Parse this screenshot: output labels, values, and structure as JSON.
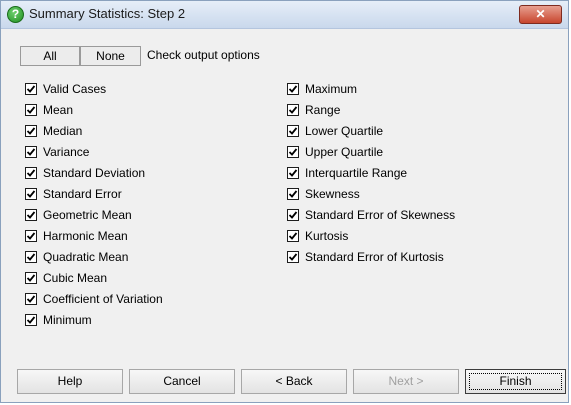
{
  "window": {
    "title": "Summary Statistics: Step 2",
    "close_label": "✕"
  },
  "top_controls": {
    "all_label": "All",
    "none_label": "None",
    "check_options_label": "Check output options"
  },
  "left_options": [
    {
      "label": "Valid Cases",
      "checked": true
    },
    {
      "label": "Mean",
      "checked": true
    },
    {
      "label": "Median",
      "checked": true
    },
    {
      "label": "Variance",
      "checked": true
    },
    {
      "label": "Standard Deviation",
      "checked": true
    },
    {
      "label": "Standard Error",
      "checked": true
    },
    {
      "label": "Geometric Mean",
      "checked": true
    },
    {
      "label": "Harmonic Mean",
      "checked": true
    },
    {
      "label": "Quadratic Mean",
      "checked": true
    },
    {
      "label": "Cubic Mean",
      "checked": true
    },
    {
      "label": "Coefficient of Variation",
      "checked": true
    },
    {
      "label": "Minimum",
      "checked": true
    }
  ],
  "right_options": [
    {
      "label": "Maximum",
      "checked": true
    },
    {
      "label": "Range",
      "checked": true
    },
    {
      "label": "Lower Quartile",
      "checked": true
    },
    {
      "label": "Upper Quartile",
      "checked": true
    },
    {
      "label": "Interquartile Range",
      "checked": true
    },
    {
      "label": "Skewness",
      "checked": true
    },
    {
      "label": "Standard Error of Skewness",
      "checked": true
    },
    {
      "label": "Kurtosis",
      "checked": true
    },
    {
      "label": "Standard Error of Kurtosis",
      "checked": true
    }
  ],
  "bottom_buttons": {
    "help": "Help",
    "cancel": "Cancel",
    "back": "< Back",
    "next": "Next >",
    "finish": "Finish"
  },
  "colors": {
    "title_icon": "#2e9e2e",
    "close_button": "#c7452d"
  }
}
